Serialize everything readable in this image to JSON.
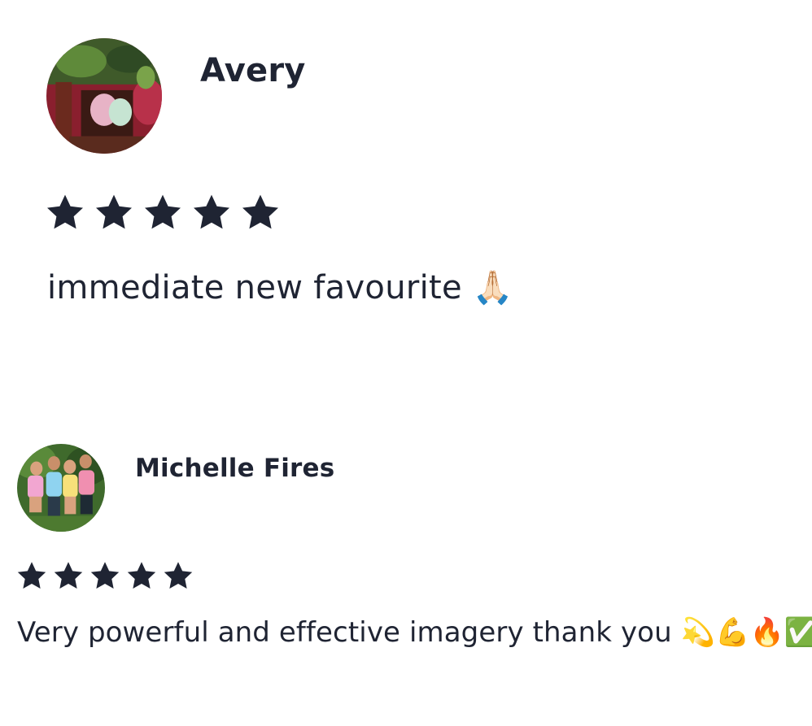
{
  "reviews": [
    {
      "reviewer": "Avery",
      "rating": 5,
      "rating_max": 5,
      "text": "immediate new favourite 🙏🏻",
      "avatar": "photo of person among plants"
    },
    {
      "reviewer": "Michelle Fires",
      "rating": 5,
      "rating_max": 5,
      "text": "Very powerful and effective imagery thank you 💫💪🔥✅",
      "avatar": "group photo of four people in tie-dye shirts"
    }
  ],
  "colors": {
    "text": "#1f2433",
    "star": "#1f2433",
    "background": "#ffffff"
  },
  "icons": {
    "star": "star-icon"
  }
}
